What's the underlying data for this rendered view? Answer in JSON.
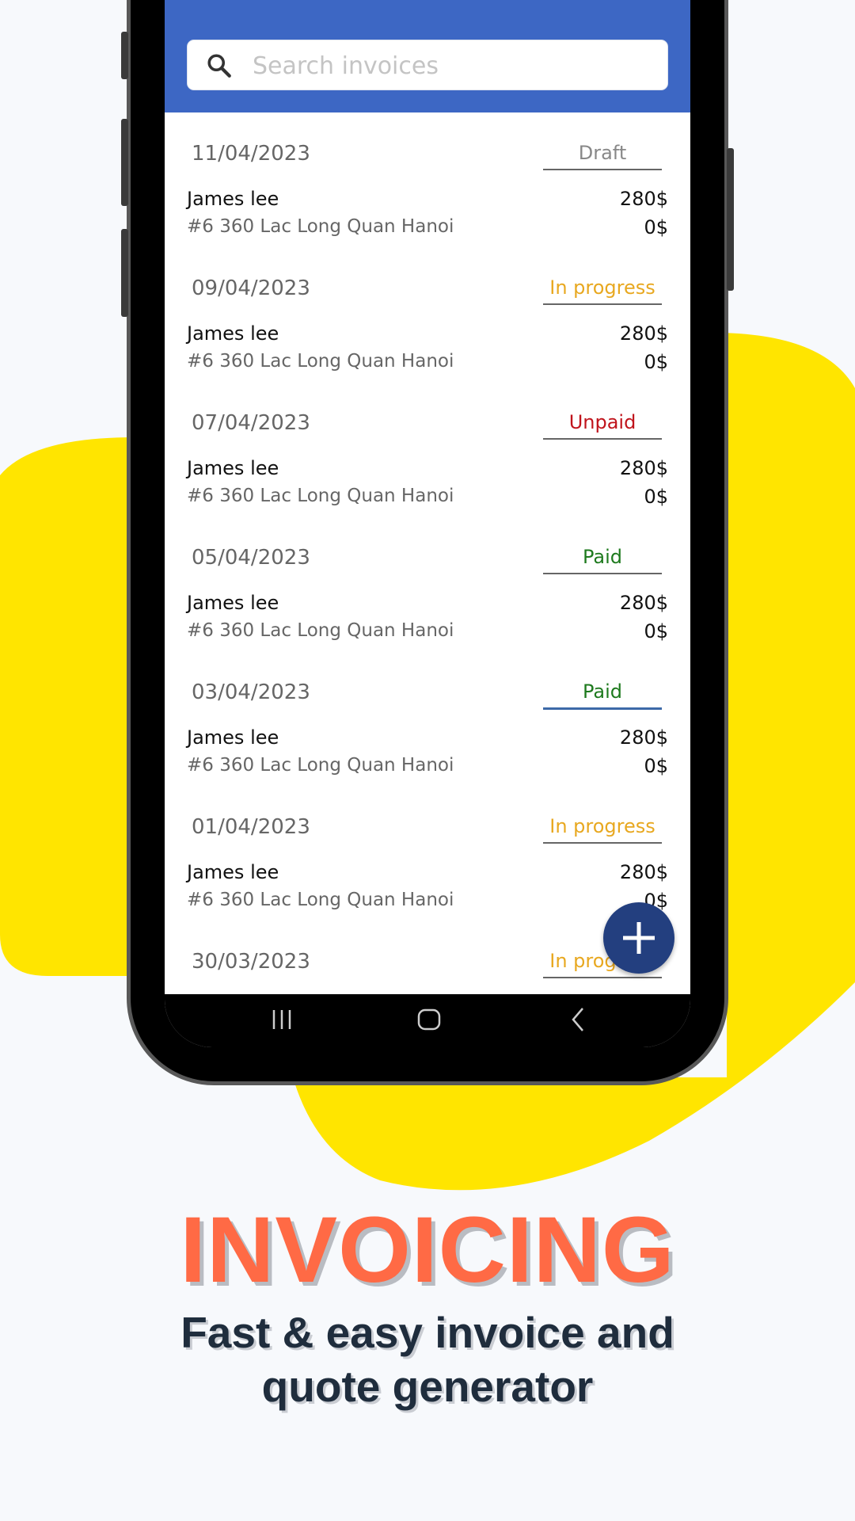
{
  "colors": {
    "accent": "#3d67c4",
    "fab": "#233f7f",
    "highlight": "#ffe500",
    "title": "#ff6a45"
  },
  "search": {
    "icon": "search-icon",
    "placeholder": "Search invoices",
    "value": ""
  },
  "invoices": [
    {
      "date": "11/04/2023",
      "status": "Draft",
      "status_color": "#888888",
      "name": "James lee",
      "address": "#6 360 Lac Long Quan Hanoi",
      "amount": "280$",
      "paid": "0$"
    },
    {
      "date": "09/04/2023",
      "status": "In progress",
      "status_color": "#e8a820",
      "name": "James lee",
      "address": "#6 360 Lac Long Quan Hanoi",
      "amount": "280$",
      "paid": "0$"
    },
    {
      "date": "07/04/2023",
      "status": "Unpaid",
      "status_color": "#c0141c",
      "name": "James lee",
      "address": "#6 360 Lac Long Quan Hanoi",
      "amount": "280$",
      "paid": "0$"
    },
    {
      "date": "05/04/2023",
      "status": "Paid",
      "status_color": "#1e7a1e",
      "name": "James lee",
      "address": "#6 360 Lac Long Quan Hanoi",
      "amount": "280$",
      "paid": "0$"
    },
    {
      "date": "03/04/2023",
      "status": "Paid",
      "status_color": "#1e7a1e",
      "name": "James lee",
      "address": "#6 360 Lac Long Quan Hanoi",
      "amount": "280$",
      "paid": "0$",
      "selected": true
    },
    {
      "date": "01/04/2023",
      "status": "In progress",
      "status_color": "#e8a820",
      "name": "James lee",
      "address": "#6 360 Lac Long Quan Hanoi",
      "amount": "280$",
      "paid": "0$"
    },
    {
      "date": "30/03/2023",
      "status": "In progress",
      "status_color": "#e8a820"
    }
  ],
  "fab": {
    "icon": "plus-icon"
  },
  "navbar": {
    "icons": [
      "recent-apps-icon",
      "home-icon",
      "back-icon"
    ]
  },
  "promo": {
    "title": "INVOICING",
    "subtitle_line1": "Fast & easy invoice and",
    "subtitle_line2": "quote generator"
  }
}
